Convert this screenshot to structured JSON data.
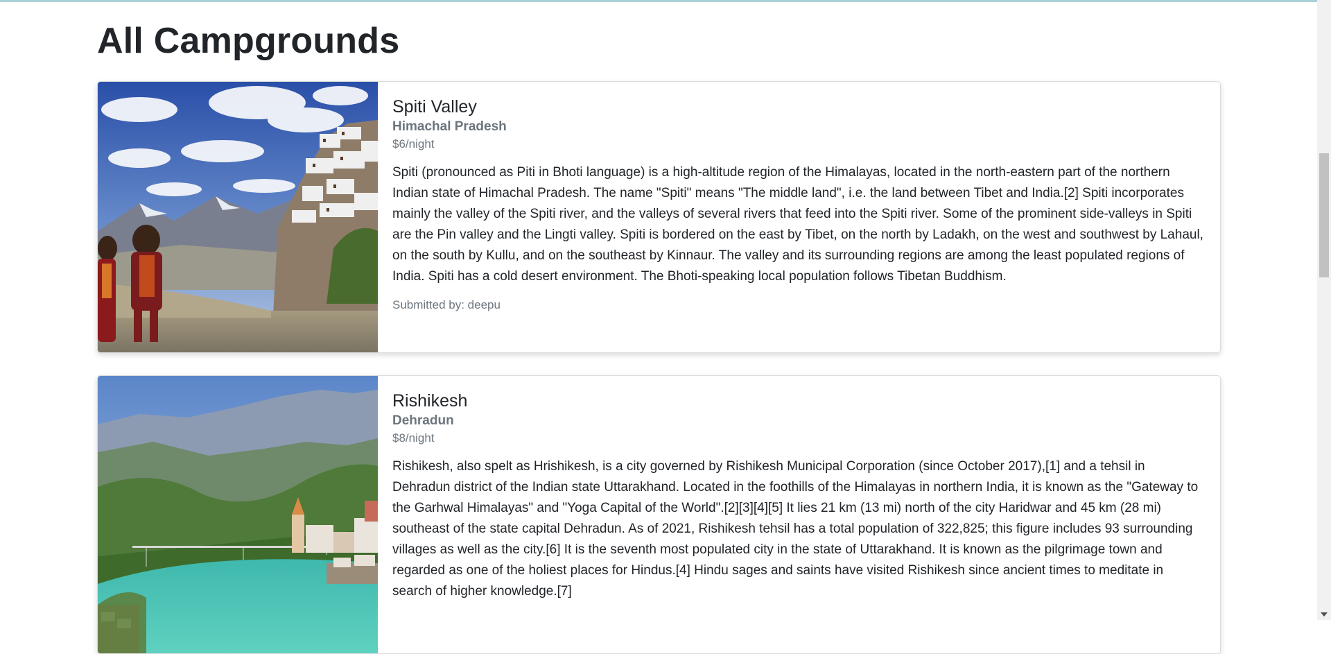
{
  "page": {
    "title": "All Campgrounds"
  },
  "campgrounds": [
    {
      "name": "Spiti Valley",
      "location": "Himachal Pradesh",
      "price": "$6/night",
      "description": "Spiti (pronounced as Piti in Bhoti language) is a high-altitude region of the Himalayas, located in the north-eastern part of the northern Indian state of Himachal Pradesh. The name \"Spiti\" means \"The middle land\", i.e. the land between Tibet and India.[2] Spiti incorporates mainly the valley of the Spiti river, and the valleys of several rivers that feed into the Spiti river. Some of the prominent side-valleys in Spiti are the Pin valley and the Lingti valley. Spiti is bordered on the east by Tibet, on the north by Ladakh, on the west and southwest by Lahaul, on the south by Kullu, and on the southeast by Kinnaur. The valley and its surrounding regions are among the least populated regions of India. Spiti has a cold desert environment. The Bhoti-speaking local population follows Tibetan Buddhism.",
      "author": "Submitted by: deepu"
    },
    {
      "name": "Rishikesh",
      "location": "Dehradun",
      "price": "$8/night",
      "description": "Rishikesh, also spelt as Hrishikesh, is a city governed by Rishikesh Municipal Corporation (since October 2017),[1] and a tehsil in Dehradun district of the Indian state Uttarakhand. Located in the foothills of the Himalayas in northern India, it is known as the \"Gateway to the Garhwal Himalayas\" and \"Yoga Capital of the World\".[2][3][4][5] It lies 21 km (13 mi) north of the city Haridwar and 45 km (28 mi) southeast of the state capital Dehradun. As of 2021, Rishikesh tehsil has a total population of 322,825; this figure includes 93 surrounding villages as well as the city.[6] It is the seventh most populated city in the state of Uttarakhand. It is known as the pilgrimage town and regarded as one of the holiest places for Hindus.[4] Hindu sages and saints have visited Rishikesh since ancient times to meditate in search of higher knowledge.[7]"
    }
  ]
}
